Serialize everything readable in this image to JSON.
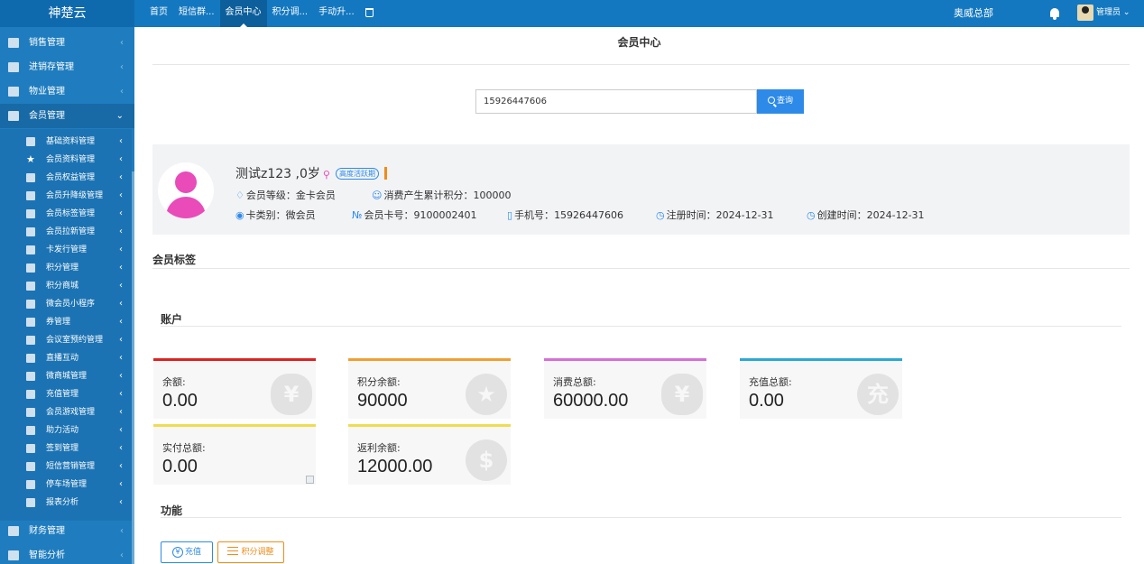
{
  "app": {
    "logo": "神楚云",
    "org": "奥威总部",
    "user": "管理员 ⌄"
  },
  "topnav": [
    {
      "label": "首页",
      "active": false
    },
    {
      "label": "短信群...",
      "active": false
    },
    {
      "label": "会员中心",
      "active": true
    },
    {
      "label": "积分调...",
      "active": false
    },
    {
      "label": "手动升...",
      "active": false
    }
  ],
  "sidebar": {
    "top_items": [
      "销售管理",
      "进销存管理",
      "物业管理",
      "会员管理"
    ],
    "sub_items": [
      "基础资料管理",
      "会员资料管理",
      "会员权益管理",
      "会员升降级管理",
      "会员标签管理",
      "会员拉新管理",
      "卡发行管理",
      "积分管理",
      "积分商城",
      "微会员小程序",
      "券管理",
      "会议室预约管理",
      "直播互动",
      "微商城管理",
      "充值管理",
      "会员游戏管理",
      "助力活动",
      "签到管理",
      "短信营销管理",
      "停车场管理",
      "报表分析"
    ],
    "bottom_items": [
      "财务管理",
      "智能分析"
    ],
    "arrow_collapsed": "‹",
    "arrow_open": "⌄"
  },
  "main": {
    "title": "会员中心",
    "search": {
      "value": "15926447606",
      "button": "查询"
    }
  },
  "profile": {
    "name": "测试z123 ,0岁",
    "activity_badge": "高度活跃期",
    "level_label": "会员等级：",
    "level_value": "金卡会员",
    "points_label": "消费产生累计积分：",
    "points_value": "100000",
    "card_type_label": "卡类别：",
    "card_type_value": "微会员",
    "card_no_label": "会员卡号：",
    "card_no_value": "9100002401",
    "phone_label": "手机号：",
    "phone_value": "15926447606",
    "reg_label": "注册时间：",
    "reg_value": "2024-12-31",
    "create_label": "创建时间：",
    "create_value": "2024-12-31"
  },
  "sections": {
    "tags": "会员标签",
    "account": "账户",
    "functions": "功能"
  },
  "cards": [
    {
      "label": "余额:",
      "value": "0.00",
      "color": "#e02020",
      "glyph": "¥"
    },
    {
      "label": "积分余额:",
      "value": "90000",
      "color": "#f0a030",
      "glyph": "★"
    },
    {
      "label": "消费总额:",
      "value": "60000.00",
      "color": "#d66fd6",
      "glyph": "¥"
    },
    {
      "label": "充值总额:",
      "value": "0.00",
      "color": "#2aa9d4",
      "glyph": "充"
    },
    {
      "label": "实付总额:",
      "value": "0.00",
      "color": "#f0dc50",
      "glyph": ""
    },
    {
      "label": "返利余额:",
      "value": "12000.00",
      "color": "#f0dc50",
      "glyph": "$"
    }
  ],
  "functions": {
    "recharge": "充值",
    "points_adjust": "积分调整"
  }
}
